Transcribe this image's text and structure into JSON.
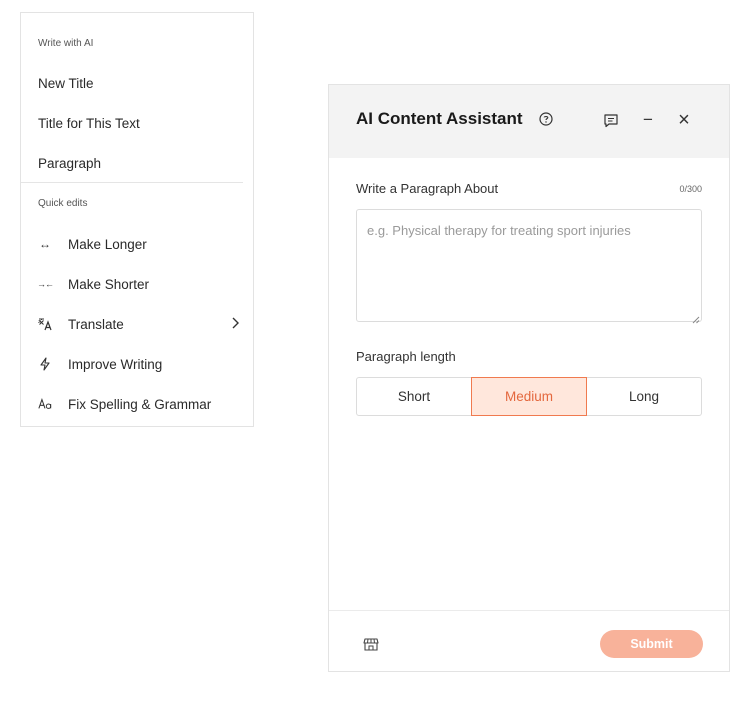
{
  "menu": {
    "section_write": "Write with AI",
    "write_items": [
      {
        "label": "New Title"
      },
      {
        "label": "Title for This Text"
      },
      {
        "label": "Paragraph"
      }
    ],
    "section_quick": "Quick edits",
    "quick_items": [
      {
        "label": "Make Longer",
        "icon": "expand-arrows-icon"
      },
      {
        "label": "Make Shorter",
        "icon": "shrink-arrows-icon"
      },
      {
        "label": "Translate",
        "icon": "translate-icon",
        "has_submenu": true
      },
      {
        "label": "Improve Writing",
        "icon": "lightning-icon"
      },
      {
        "label": "Fix Spelling & Grammar",
        "icon": "spelling-icon"
      }
    ],
    "icon_glyphs": {
      "expand": "↔",
      "shrink": "→←",
      "chevron": "›"
    }
  },
  "panel": {
    "title": "AI Content Assistant",
    "field_label": "Write a Paragraph About",
    "char_count": "0/300",
    "textarea": {
      "value": "",
      "placeholder": "e.g. Physical therapy for treating sport injuries"
    },
    "length_label": "Paragraph length",
    "length_options": [
      {
        "label": "Short",
        "selected": false
      },
      {
        "label": "Medium",
        "selected": true
      },
      {
        "label": "Long",
        "selected": false
      }
    ],
    "submit_label": "Submit",
    "header_buttons": {
      "minimize": "−",
      "close": "×"
    }
  },
  "colors": {
    "accent": "#f07a4f",
    "accent_light": "#ffe7dc",
    "submit_bg": "#f8b29a",
    "header_bg": "#f3f3f3"
  }
}
